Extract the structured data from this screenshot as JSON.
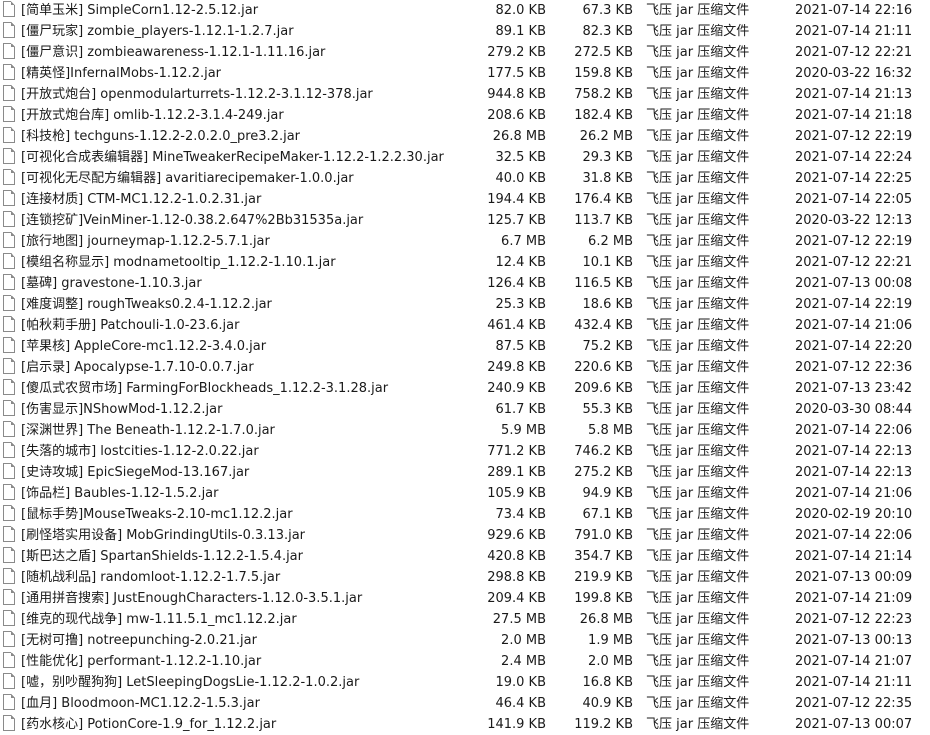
{
  "files": [
    {
      "name": "[简单玉米] SimpleCorn1.12-2.5.12.jar",
      "packed": "82.0 KB",
      "size": "67.3 KB",
      "type": "飞压 jar 压缩文件",
      "modified": "2021-07-14 22:16"
    },
    {
      "name": "[僵尸玩家] zombie_players-1.12.1-1.2.7.jar",
      "packed": "89.1 KB",
      "size": "82.3 KB",
      "type": "飞压 jar 压缩文件",
      "modified": "2021-07-14 21:11"
    },
    {
      "name": "[僵尸意识] zombieawareness-1.12.1-1.11.16.jar",
      "packed": "279.2 KB",
      "size": "272.5 KB",
      "type": "飞压 jar 压缩文件",
      "modified": "2021-07-12 22:21"
    },
    {
      "name": "[精英怪]InfernalMobs-1.12.2.jar",
      "packed": "177.5 KB",
      "size": "159.8 KB",
      "type": "飞压 jar 压缩文件",
      "modified": "2020-03-22 16:32"
    },
    {
      "name": "[开放式炮台] openmodularturrets-1.12.2-3.1.12-378.jar",
      "packed": "944.8 KB",
      "size": "758.2 KB",
      "type": "飞压 jar 压缩文件",
      "modified": "2021-07-14 21:13"
    },
    {
      "name": "[开放式炮台库] omlib-1.12.2-3.1.4-249.jar",
      "packed": "208.6 KB",
      "size": "182.4 KB",
      "type": "飞压 jar 压缩文件",
      "modified": "2021-07-14 21:18"
    },
    {
      "name": "[科技枪] techguns-1.12.2-2.0.2.0_pre3.2.jar",
      "packed": "26.8 MB",
      "size": "26.2 MB",
      "type": "飞压 jar 压缩文件",
      "modified": "2021-07-12 22:19"
    },
    {
      "name": "[可视化合成表编辑器] MineTweakerRecipeMaker-1.12.2-1.2.2.30.jar",
      "packed": "32.5 KB",
      "size": "29.3 KB",
      "type": "飞压 jar 压缩文件",
      "modified": "2021-07-14 22:24"
    },
    {
      "name": "[可视化无尽配方编辑器] avaritiarecipemaker-1.0.0.jar",
      "packed": "40.0 KB",
      "size": "31.8 KB",
      "type": "飞压 jar 压缩文件",
      "modified": "2021-07-14 22:25"
    },
    {
      "name": "[连接材质] CTM-MC1.12.2-1.0.2.31.jar",
      "packed": "194.4 KB",
      "size": "176.4 KB",
      "type": "飞压 jar 压缩文件",
      "modified": "2021-07-14 22:05"
    },
    {
      "name": "[连锁挖矿]VeinMiner-1.12-0.38.2.647%2Bb31535a.jar",
      "packed": "125.7 KB",
      "size": "113.7 KB",
      "type": "飞压 jar 压缩文件",
      "modified": "2020-03-22 12:13"
    },
    {
      "name": "[旅行地图] journeymap-1.12.2-5.7.1.jar",
      "packed": "6.7 MB",
      "size": "6.2 MB",
      "type": "飞压 jar 压缩文件",
      "modified": "2021-07-12 22:19"
    },
    {
      "name": "[模组名称显示] modnametooltip_1.12.2-1.10.1.jar",
      "packed": "12.4 KB",
      "size": "10.1 KB",
      "type": "飞压 jar 压缩文件",
      "modified": "2021-07-12 22:21"
    },
    {
      "name": "[墓碑] gravestone-1.10.3.jar",
      "packed": "126.4 KB",
      "size": "116.5 KB",
      "type": "飞压 jar 压缩文件",
      "modified": "2021-07-13 00:08"
    },
    {
      "name": "[难度调整] roughTweaks0.2.4-1.12.2.jar",
      "packed": "25.3 KB",
      "size": "18.6 KB",
      "type": "飞压 jar 压缩文件",
      "modified": "2021-07-14 22:19"
    },
    {
      "name": "[帕秋莉手册] Patchouli-1.0-23.6.jar",
      "packed": "461.4 KB",
      "size": "432.4 KB",
      "type": "飞压 jar 压缩文件",
      "modified": "2021-07-14 21:06"
    },
    {
      "name": "[苹果核] AppleCore-mc1.12.2-3.4.0.jar",
      "packed": "87.5 KB",
      "size": "75.2 KB",
      "type": "飞压 jar 压缩文件",
      "modified": "2021-07-14 22:20"
    },
    {
      "name": "[启示录] Apocalypse-1.7.10-0.0.7.jar",
      "packed": "249.8 KB",
      "size": "220.6 KB",
      "type": "飞压 jar 压缩文件",
      "modified": "2021-07-12 22:36"
    },
    {
      "name": "[傻瓜式农贸市场] FarmingForBlockheads_1.12.2-3.1.28.jar",
      "packed": "240.9 KB",
      "size": "209.6 KB",
      "type": "飞压 jar 压缩文件",
      "modified": "2021-07-13 23:42"
    },
    {
      "name": "[伤害显示]NShowMod-1.12.2.jar",
      "packed": "61.7 KB",
      "size": "55.3 KB",
      "type": "飞压 jar 压缩文件",
      "modified": "2020-03-30 08:44"
    },
    {
      "name": "[深渊世界] The Beneath-1.12.2-1.7.0.jar",
      "packed": "5.9 MB",
      "size": "5.8 MB",
      "type": "飞压 jar 压缩文件",
      "modified": "2021-07-14 22:06"
    },
    {
      "name": "[失落的城市] lostcities-1.12-2.0.22.jar",
      "packed": "771.2 KB",
      "size": "746.2 KB",
      "type": "飞压 jar 压缩文件",
      "modified": "2021-07-14 22:13"
    },
    {
      "name": "[史诗攻城] EpicSiegeMod-13.167.jar",
      "packed": "289.1 KB",
      "size": "275.2 KB",
      "type": "飞压 jar 压缩文件",
      "modified": "2021-07-14 22:13"
    },
    {
      "name": "[饰品栏] Baubles-1.12-1.5.2.jar",
      "packed": "105.9 KB",
      "size": "94.9 KB",
      "type": "飞压 jar 压缩文件",
      "modified": "2021-07-14 21:06"
    },
    {
      "name": "[鼠标手势]MouseTweaks-2.10-mc1.12.2.jar",
      "packed": "73.4 KB",
      "size": "67.1 KB",
      "type": "飞压 jar 压缩文件",
      "modified": "2020-02-19 20:10"
    },
    {
      "name": "[刷怪塔实用设备] MobGrindingUtils-0.3.13.jar",
      "packed": "929.6 KB",
      "size": "791.0 KB",
      "type": "飞压 jar 压缩文件",
      "modified": "2021-07-14 22:06"
    },
    {
      "name": "[斯巴达之盾] SpartanShields-1.12.2-1.5.4.jar",
      "packed": "420.8 KB",
      "size": "354.7 KB",
      "type": "飞压 jar 压缩文件",
      "modified": "2021-07-14 21:14"
    },
    {
      "name": "[随机战利品] randomloot-1.12.2-1.7.5.jar",
      "packed": "298.8 KB",
      "size": "219.9 KB",
      "type": "飞压 jar 压缩文件",
      "modified": "2021-07-13 00:09"
    },
    {
      "name": "[通用拼音搜索] JustEnoughCharacters-1.12.0-3.5.1.jar",
      "packed": "209.4 KB",
      "size": "199.8 KB",
      "type": "飞压 jar 压缩文件",
      "modified": "2021-07-14 21:09"
    },
    {
      "name": "[维克的现代战争] mw-1.11.5.1_mc1.12.2.jar",
      "packed": "27.5 MB",
      "size": "26.8 MB",
      "type": "飞压 jar 压缩文件",
      "modified": "2021-07-12 22:23"
    },
    {
      "name": "[无树可撸] notreepunching-2.0.21.jar",
      "packed": "2.0 MB",
      "size": "1.9 MB",
      "type": "飞压 jar 压缩文件",
      "modified": "2021-07-13 00:13"
    },
    {
      "name": "[性能优化] performant-1.12.2-1.10.jar",
      "packed": "2.4 MB",
      "size": "2.0 MB",
      "type": "飞压 jar 压缩文件",
      "modified": "2021-07-14 21:07"
    },
    {
      "name": "[嘘，别吵醒狗狗] LetSleepingDogsLie-1.12.2-1.0.2.jar",
      "packed": "19.0 KB",
      "size": "16.8 KB",
      "type": "飞压 jar 压缩文件",
      "modified": "2021-07-14 21:11"
    },
    {
      "name": "[血月] Bloodmoon-MC1.12.2-1.5.3.jar",
      "packed": "46.4 KB",
      "size": "40.9 KB",
      "type": "飞压 jar 压缩文件",
      "modified": "2021-07-12 22:35"
    },
    {
      "name": "[药水核心] PotionCore-1.9_for_1.12.2.jar",
      "packed": "141.9 KB",
      "size": "119.2 KB",
      "type": "飞压 jar 压缩文件",
      "modified": "2021-07-13 00:07"
    }
  ]
}
